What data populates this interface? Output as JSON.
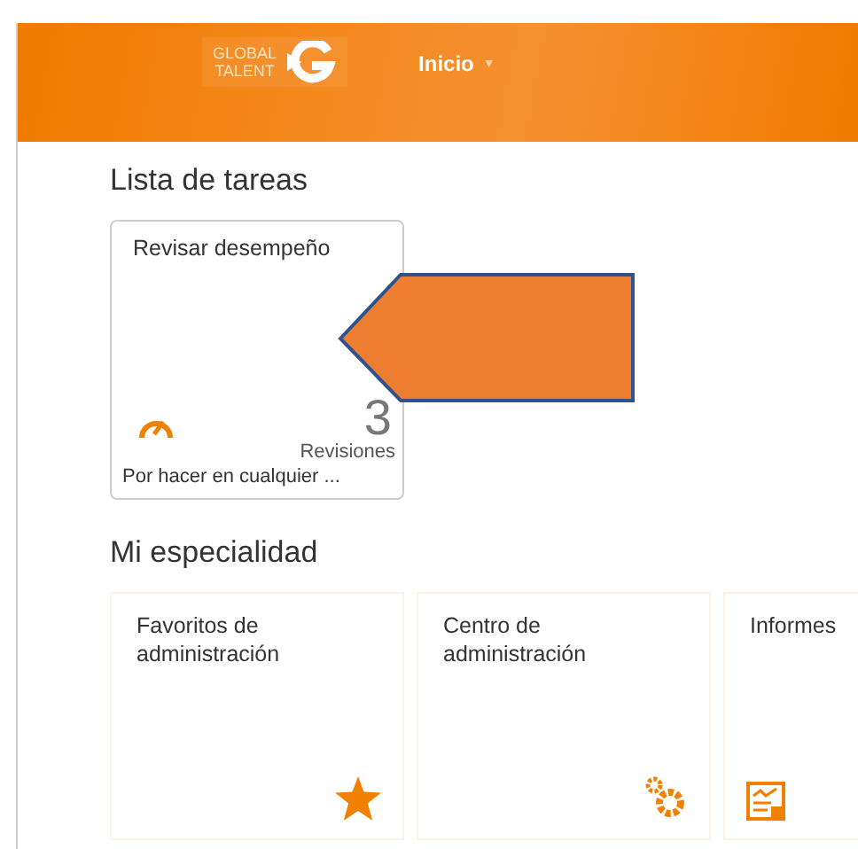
{
  "header": {
    "logo": {
      "line1": "GLOBAL",
      "line2": "TALENT"
    },
    "menu": {
      "label": "Inicio",
      "caret": "▼"
    }
  },
  "task_section": {
    "title": "Lista de tareas",
    "tiles": [
      {
        "title": "Revisar desempeño",
        "kind": "gauge",
        "count": "3",
        "unit": "Revisiones",
        "footer": "Por hacer en cualquier ..."
      }
    ]
  },
  "specialty_section": {
    "title": "Mi especialidad",
    "tiles": [
      {
        "title": "Favoritos de administración",
        "kind": "star"
      },
      {
        "title": "Centro de administración",
        "kind": "gears"
      },
      {
        "title": "Informes",
        "kind": "report"
      }
    ]
  }
}
